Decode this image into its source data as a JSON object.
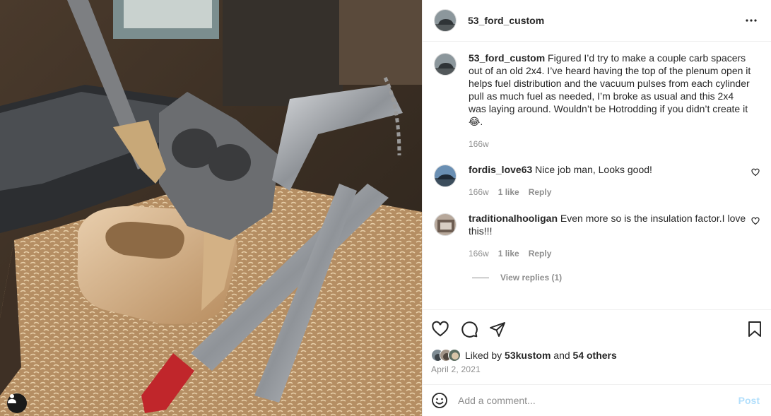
{
  "post": {
    "author": "53_ford_custom",
    "more_icon": "more-horizontal-icon",
    "caption": {
      "username": "53_ford_custom",
      "text": "Figured I’d try to make a couple carb spacers out of an old 2x4. I’ve heard having the top of the plenum open it helps fuel distribution and the vacuum pulses from each cylinder pull as much fuel as needed, I’m broke as usual and this 2x4 was laying around. Wouldn’t be Hotrodding if you didn’t create it😂.",
      "age": "166w"
    }
  },
  "comments": [
    {
      "username": "fordis_love63",
      "text": "Nice job man, Looks good!",
      "age": "166w",
      "likes": "1 like",
      "reply": "Reply"
    },
    {
      "username": "traditionalhooligan",
      "text": "Even more so is the insulation factor.I love this!!!",
      "age": "166w",
      "likes": "1 like",
      "reply": "Reply",
      "view_replies": "View replies (1)"
    }
  ],
  "engagement": {
    "liked_by_prefix": "Liked by",
    "liked_by_user": "53kustom",
    "and": "and",
    "others": "54 others",
    "date": "April 2, 2021"
  },
  "add_comment": {
    "placeholder": "Add a comment...",
    "post_label": "Post"
  },
  "colors": {
    "text": "#262626",
    "muted": "#8e8e8e",
    "post_disabled": "#b2dffc",
    "divider": "#efefef"
  }
}
